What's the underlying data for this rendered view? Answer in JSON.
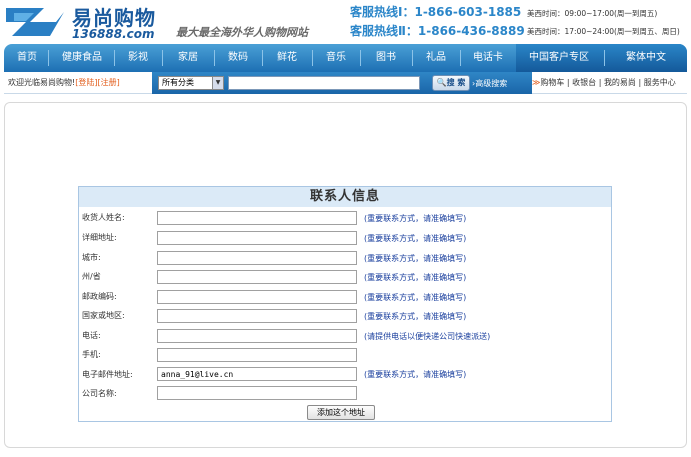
{
  "header": {
    "logo_cn": "易尚购物",
    "logo_url": "136888.com",
    "slogan": "最大最全海外华人购物网站",
    "hotline1": "客服热线Ⅰ：1-866-603-1885",
    "hotline2": "客服热线Ⅱ：1-866-436-8889",
    "hours1": "美西时间：09:00~17:00(周一到周五)",
    "hours2": "美西时间：17:00~24:00(周一到周五、周日)"
  },
  "nav": {
    "items": [
      "首页",
      "健康食品",
      "影视",
      "家居",
      "数码",
      "鲜花",
      "音乐",
      "图书",
      "礼品",
      "电话卡"
    ],
    "china_zone": "中国客户专区",
    "traditional": "繁体中文"
  },
  "searchbar": {
    "welcome": "欢迎光临易尚购物!",
    "login": "[登陆]",
    "register": "[注册]",
    "category_value": "所有分类",
    "search_value": "",
    "search_button": "搜 索",
    "advanced_search": "高级搜索",
    "cart": "购物车",
    "checkout": "收银台",
    "my_account": "我的易尚",
    "service_center": "服务中心"
  },
  "form": {
    "title": "联系人信息",
    "fields": [
      {
        "label": "收货人姓名:",
        "value": "",
        "hint": "(重要联系方式，请准确填写)"
      },
      {
        "label": "详细地址:",
        "value": "",
        "hint": "(重要联系方式，请准确填写)"
      },
      {
        "label": "城市:",
        "value": "",
        "hint": "(重要联系方式，请准确填写)"
      },
      {
        "label": "州/省",
        "value": "",
        "hint": "(重要联系方式，请准确填写)"
      },
      {
        "label": "邮政编码:",
        "value": "",
        "hint": "(重要联系方式，请准确填写)"
      },
      {
        "label": "国家或地区:",
        "value": "",
        "hint": "(重要联系方式，请准确填写)"
      },
      {
        "label": "电话:",
        "value": "",
        "hint": "(请提供电话以便快递公司快速派送)"
      },
      {
        "label": "手机:",
        "value": "",
        "hint": ""
      },
      {
        "label": "电子邮件地址:",
        "value": "anna_91@live.cn",
        "hint": "(重要联系方式，请准确填写)"
      },
      {
        "label": "公司名称:",
        "value": "",
        "hint": ""
      }
    ],
    "submit": "添加这个地址"
  },
  "colors": {
    "brand_blue": "#1a5a9e",
    "nav_blue": "#1d6fb3",
    "hotline_blue": "#2b86c9",
    "hint_blue": "#1a3f9e",
    "link_orange": "#e25d1b"
  }
}
